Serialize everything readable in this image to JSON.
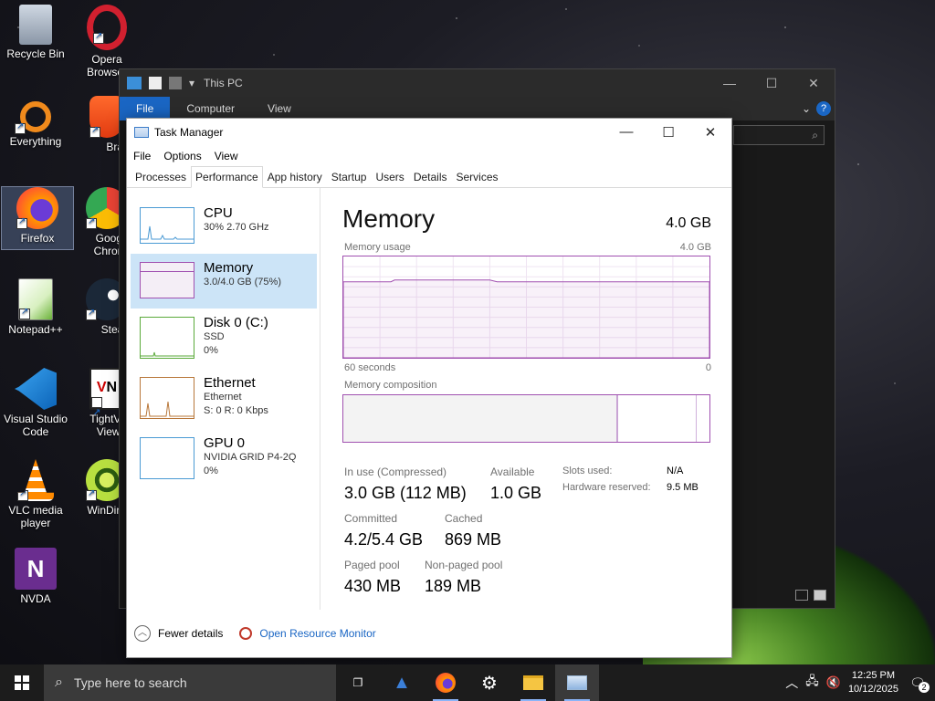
{
  "desktop": {
    "icons": [
      {
        "label": "Recycle Bin"
      },
      {
        "label": "Opera Browser"
      },
      {
        "label": "Everything"
      },
      {
        "label": "Brave"
      },
      {
        "label": "Firefox"
      },
      {
        "label": "Google Chrome"
      },
      {
        "label": "Notepad++"
      },
      {
        "label": "Steam"
      },
      {
        "label": "Visual Studio Code"
      },
      {
        "label": "TightVNC Viewer"
      },
      {
        "label": "VLC media player"
      },
      {
        "label": "WinDirStat"
      },
      {
        "label": "NVDA"
      }
    ]
  },
  "explorer": {
    "title": "This PC",
    "ribbon_tabs": [
      "File",
      "Computer",
      "View"
    ],
    "help": "?"
  },
  "task_manager": {
    "title": "Task Manager",
    "menu": [
      "File",
      "Options",
      "View"
    ],
    "tabs": [
      "Processes",
      "Performance",
      "App history",
      "Startup",
      "Users",
      "Details",
      "Services"
    ],
    "active_tab": "Performance",
    "resources": [
      {
        "name": "CPU",
        "line1": "30%  2.70 GHz",
        "line2": ""
      },
      {
        "name": "Memory",
        "line1": "3.0/4.0 GB (75%)",
        "line2": ""
      },
      {
        "name": "Disk 0 (C:)",
        "line1": "SSD",
        "line2": "0%"
      },
      {
        "name": "Ethernet",
        "line1": "Ethernet",
        "line2": "S: 0  R: 0 Kbps"
      },
      {
        "name": "GPU 0",
        "line1": "NVIDIA GRID P4-2Q",
        "line2": "0%"
      }
    ],
    "detail": {
      "title": "Memory",
      "total": "4.0 GB",
      "usage_label": "Memory usage",
      "usage_max": "4.0 GB",
      "time_left": "60 seconds",
      "time_right": "0",
      "composition_label": "Memory composition",
      "in_use_label": "In use (Compressed)",
      "in_use_value": "3.0 GB (112 MB)",
      "available_label": "Available",
      "available_value": "1.0 GB",
      "committed_label": "Committed",
      "committed_value": "4.2/5.4 GB",
      "cached_label": "Cached",
      "cached_value": "869 MB",
      "paged_label": "Paged pool",
      "paged_value": "430 MB",
      "nonpaged_label": "Non-paged pool",
      "nonpaged_value": "189 MB",
      "slots_label": "Slots used:",
      "slots_value": "N/A",
      "hw_label": "Hardware reserved:",
      "hw_value": "9.5 MB",
      "usage_fraction": 0.75
    },
    "footer": {
      "fewer_details": "Fewer details",
      "resource_monitor": "Open Resource Monitor"
    }
  },
  "taskbar": {
    "search_placeholder": "Type here to search",
    "time": "12:25 PM",
    "date": "10/12/2025",
    "notification_count": "2"
  },
  "colors": {
    "memory_accent": "#a050b0",
    "cpu_accent": "#4a9ad4",
    "disk_accent": "#5aaa3a",
    "ethernet_accent": "#b8773a",
    "selection": "#cce4f7",
    "taskbar": "#1c1c1c",
    "link": "#1a66c4"
  }
}
